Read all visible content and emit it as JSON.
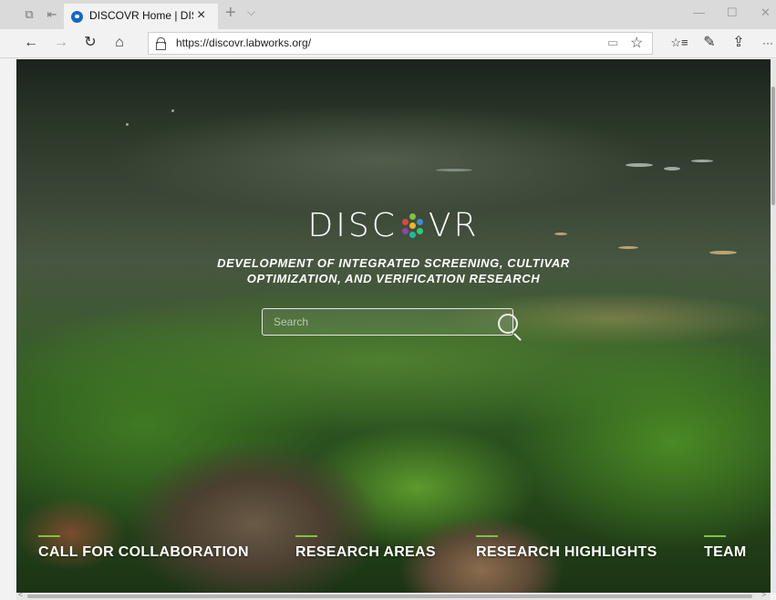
{
  "tab": {
    "title": "DISCOVR Home | DISCOVR",
    "close": "×"
  },
  "tabstrip": {
    "new_tab": "+",
    "tab_menu": "⌵",
    "set_aside": "⧉",
    "show_aside": "⇤"
  },
  "window": {
    "minimize": "—",
    "maximize": "☐",
    "close": "✕"
  },
  "nav": {
    "back": "←",
    "forward": "→",
    "refresh": "↻",
    "home": "⌂"
  },
  "address": {
    "url": "https://discovr.labworks.org/",
    "reading_view": "▭",
    "favorite": "☆"
  },
  "toolbar": {
    "favorites": "☆≡",
    "notes": "✎",
    "share": "⇪",
    "more": "···"
  },
  "page": {
    "brand_left": "DISC",
    "brand_right": "VR",
    "logo_dot_colors": [
      "#7cc43f",
      "#e0463c",
      "#3a8fd4",
      "#f0b429",
      "#8e44ad",
      "#2ecc71",
      "#1abc9c"
    ],
    "tagline_line1": "DEVELOPMENT OF INTEGRATED SCREENING, CULTIVAR",
    "tagline_line2": "OPTIMIZATION, AND VERIFICATION RESEARCH",
    "search_placeholder": "Search",
    "accent_color": "#7cc43f",
    "nav": [
      {
        "label": "CALL FOR COLLABORATION"
      },
      {
        "label": "RESEARCH AREAS"
      },
      {
        "label": "RESEARCH HIGHLIGHTS"
      },
      {
        "label": "TEAM"
      }
    ]
  },
  "scroll": {
    "left_arrow": "<",
    "right_arrow": ">"
  }
}
